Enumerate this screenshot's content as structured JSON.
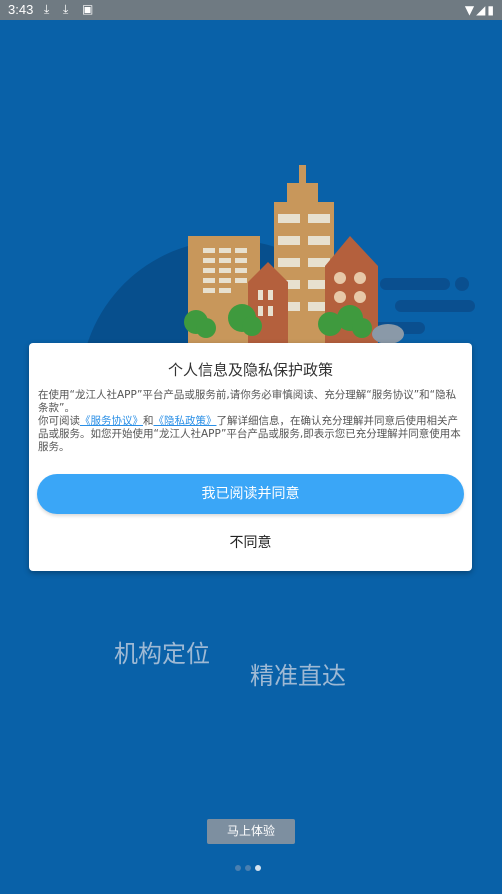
{
  "status_bar": {
    "time": "3:43"
  },
  "dialog": {
    "title": "个人信息及隐私保护政策",
    "para1": "在使用“龙江人社APP”平台产品或服务前,请你务必审慎阅读、充分理解“服务协议”和“隐私条款”。",
    "para2_prefix": "你可阅读",
    "link_service": "《服务协议》",
    "para2_and": "和",
    "link_privacy": "《隐私政策》",
    "para2_suffix": "了解详细信息，在确认充分理解并同意后使用相关产品或服务。如您开始使用“龙江人社APP”平台产品或服务,即表示您已充分理解并同意使用本服务。",
    "agree_label": "我已阅读并同意",
    "disagree_label": "不同意"
  },
  "onboarding": {
    "slogan_left": "机构定位",
    "slogan_right": "精准直达",
    "try_button": "马上体验",
    "page_count": 3,
    "active_page": 3
  },
  "colors": {
    "background": "#0961a8",
    "accent": "#3aa6f7"
  }
}
